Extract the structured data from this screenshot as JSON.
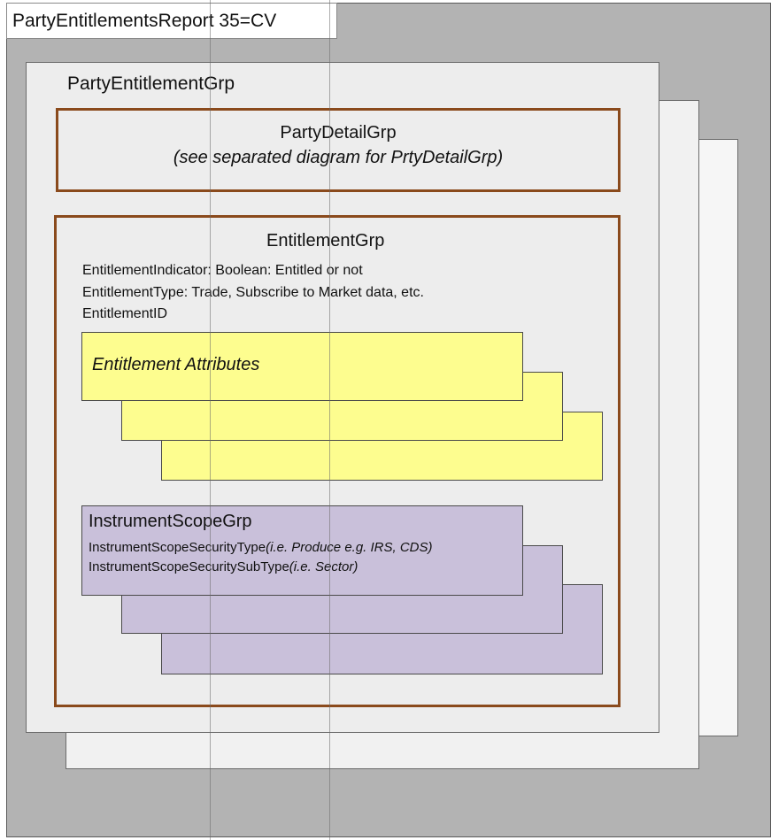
{
  "report_tab": {
    "label": "PartyEntitlementsReport 35=CV"
  },
  "party_entitlement_grp": {
    "label": "PartyEntitlementGrp"
  },
  "party_detail_grp": {
    "title": "PartyDetailGrp",
    "note": "(see separated diagram for PrtyDetailGrp)"
  },
  "entitlement_grp": {
    "title": "EntitlementGrp",
    "fields": [
      "EntitlementIndicator: Boolean: Entitled or not",
      "EntitlementType: Trade, Subscribe to Market data, etc.",
      "EntitlementID"
    ]
  },
  "entitlement_attributes": {
    "label": "Entitlement Attributes"
  },
  "instrument_scope_grp": {
    "title": "InstrumentScopeGrp",
    "line1_field": "InstrumentScopeSecurityType",
    "line1_note": "(i.e. Produce e.g. IRS, CDS)",
    "line2_field": "InstrumentScopeSecuritySubType",
    "line2_note": "(i.e. Sector)"
  },
  "colors": {
    "group_border": "#8a4a1c",
    "attributes_fill": "#fdfd8f",
    "instrument_fill": "#c9c0da",
    "background": "#b3b3b3"
  }
}
